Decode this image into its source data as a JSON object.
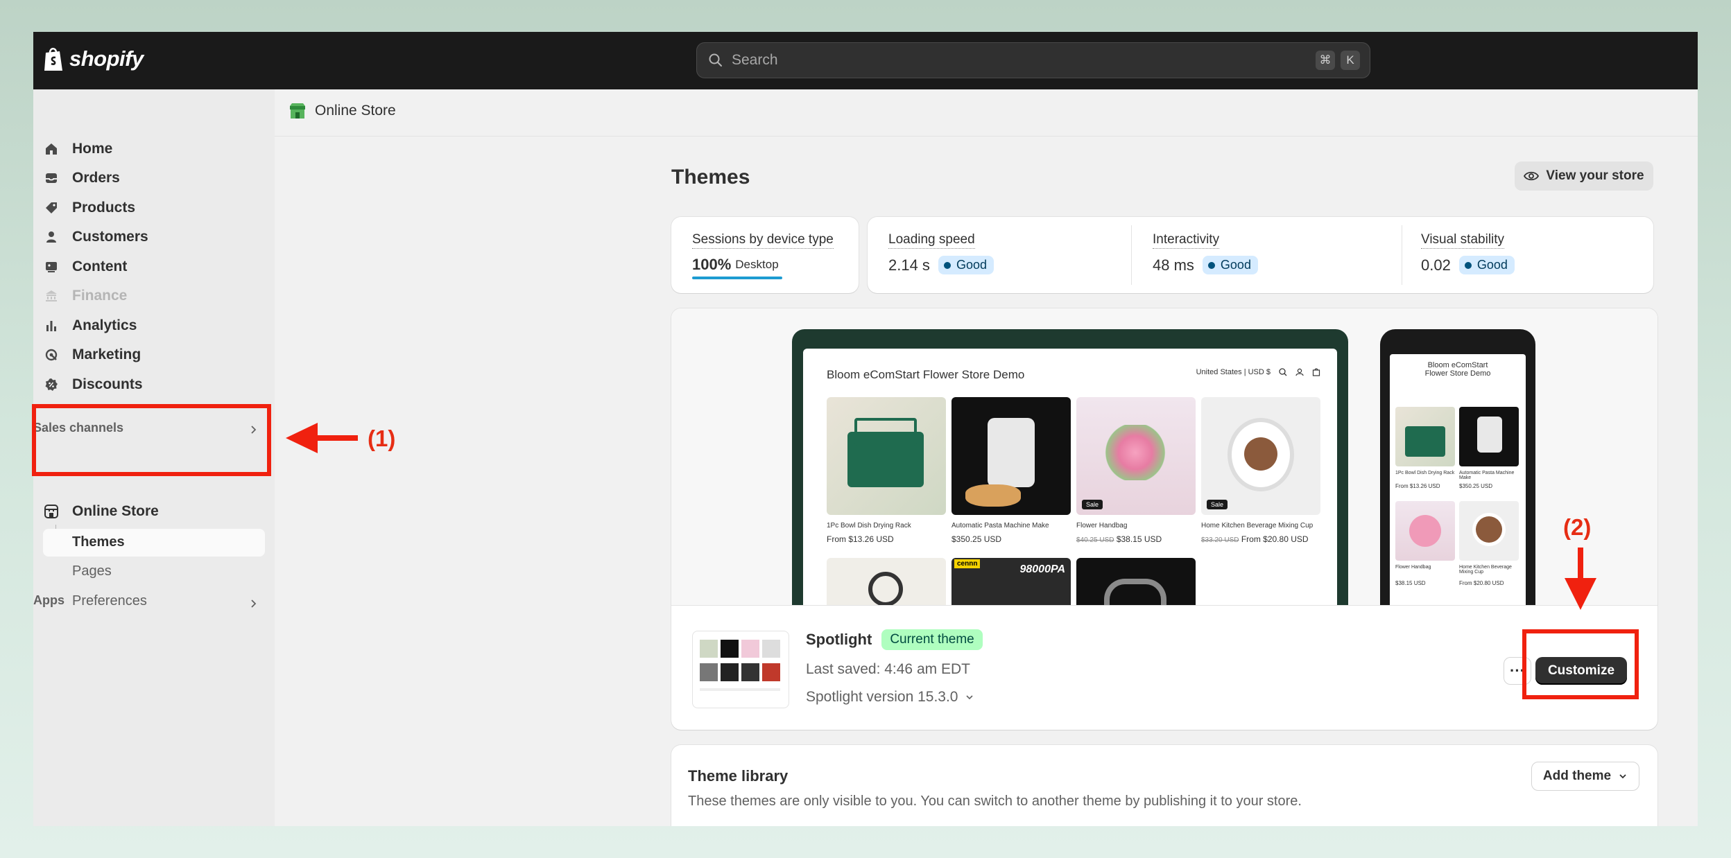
{
  "topbar": {
    "logo_text": "shopify",
    "search_placeholder": "Search",
    "kbd_cmd": "⌘",
    "kbd_k": "K"
  },
  "sidebar": {
    "items": [
      {
        "label": "Home"
      },
      {
        "label": "Orders"
      },
      {
        "label": "Products"
      },
      {
        "label": "Customers"
      },
      {
        "label": "Content"
      },
      {
        "label": "Finance"
      },
      {
        "label": "Analytics"
      },
      {
        "label": "Marketing"
      },
      {
        "label": "Discounts"
      }
    ],
    "sales_channels_label": "Sales channels",
    "online_store_label": "Online Store",
    "sub_items": {
      "themes": "Themes",
      "pages": "Pages",
      "preferences": "Preferences"
    },
    "apps_label": "Apps"
  },
  "breadcrumb": {
    "label": "Online Store"
  },
  "page": {
    "title": "Themes",
    "view_store": "View your store"
  },
  "metrics": {
    "sessions": {
      "label": "Sessions by device type",
      "value": "100%",
      "device": "Desktop"
    },
    "loading": {
      "label": "Loading speed",
      "value": "2.14 s",
      "status": "Good"
    },
    "interactivity": {
      "label": "Interactivity",
      "value": "48 ms",
      "status": "Good"
    },
    "visual": {
      "label": "Visual stability",
      "value": "0.02",
      "status": "Good"
    }
  },
  "preview": {
    "store_title": "Bloom eComStart Flower Store Demo",
    "region": "United States | USD $",
    "phone_title": "Bloom eComStart Flower Store Demo",
    "products": [
      {
        "name": "1Pc Bowl Dish Drying Rack",
        "price": "From $13.26 USD",
        "old": "",
        "sale": ""
      },
      {
        "name": "Automatic Pasta Machine Make",
        "price": "$350.25 USD",
        "old": "",
        "sale": ""
      },
      {
        "name": "Flower Handbag",
        "price": "$38.15 USD",
        "old": "$40.25 USD",
        "sale": "Sale"
      },
      {
        "name": "Home Kitchen Beverage Mixing Cup",
        "price": "From $20.80 USD",
        "old": "$33.20 USD",
        "sale": "Sale"
      }
    ],
    "row2_brand": "cennn",
    "row2_label": "98000PA"
  },
  "current_theme": {
    "name": "Spotlight",
    "badge": "Current theme",
    "saved": "Last saved: 4:46 am EDT",
    "version": "Spotlight version 15.3.0",
    "more": "···",
    "customize": "Customize"
  },
  "library": {
    "title": "Theme library",
    "desc": "These themes are only visible to you. You can switch to another theme by publishing it to your store.",
    "add_theme": "Add theme"
  },
  "annotations": {
    "label1": "(1)",
    "label2": "(2)",
    "color": "#f0210f"
  }
}
